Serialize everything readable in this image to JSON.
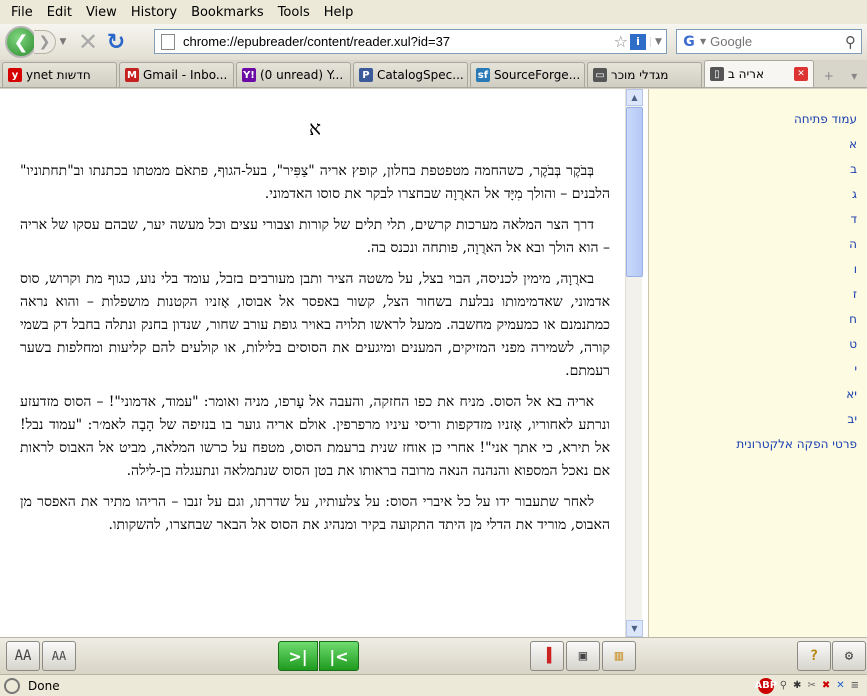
{
  "menubar": {
    "items": [
      "File",
      "Edit",
      "View",
      "History",
      "Bookmarks",
      "Tools",
      "Help"
    ]
  },
  "navbar": {
    "url": "chrome://epubreader/content/reader.xul?id=37",
    "search_placeholder": "Google"
  },
  "tabs": [
    {
      "label": "ynet חדשות",
      "icon": "ynet-icon",
      "color": "#d40000",
      "glyph": "y"
    },
    {
      "label": "Gmail - Inbo...",
      "icon": "gmail-icon",
      "color": "#c5221f",
      "glyph": "M"
    },
    {
      "label": "(0 unread) Y...",
      "icon": "yahoo-icon",
      "color": "#6b0aa5",
      "glyph": "Y!"
    },
    {
      "label": "CatalogSpec...",
      "icon": "catalog-icon",
      "color": "#3a5a9a",
      "glyph": "P"
    },
    {
      "label": "SourceForge...",
      "icon": "sourceforge-icon",
      "color": "#2a7ab8",
      "glyph": "sf"
    },
    {
      "label": "מגדלי מוכר",
      "icon": "book-icon",
      "color": "#555555",
      "glyph": "▭"
    },
    {
      "label": "אריה ב",
      "icon": "page-icon",
      "color": "#555555",
      "glyph": "▯",
      "active": true
    }
  ],
  "reader": {
    "chapter": "א",
    "paragraphs": [
      "בְּבֹקֶר בְּבֹקֶר, כשהחמה מטפטפת בחלון, קופץ אריה \"צַפִּיר\", בעל-הגוף, פתאֹם ממטתו בכתנתו וב\"תחתוניו\" הלבנים – והולך מִיָּד אל הארֻוָה שבחצרו לבקר את סוסו האדמוני.",
      "דרך הצר המלאה מערכות קרשים, תלי תלים של קורות וצבורי עצים וכל מעשה יער, שבהם עסקו של אריה – הוא הולך ובא אל הארֻוָה, פותחה ונכנס בה.",
      "בארֻוָה, מימין לכניסה, הבוי בצל, על משטה הציר ותבן מעורבים בזבל, עומד בלי נוע, כגוף מת וקרוש, סוס אדמוני, שאדמימותו נבלעת בשחור הצל, קשור באפסר אל אבוסו, אָזניו הקטנות מושפלות – והוא נראה כמתנמנם או כמעמיק מחשבה. ממעל לראשו תלויה באויר גופת עורב שחור, שנדון בחנק ונתלה בחבל דק בשמי קורה, לשמירה מפני המזיקים, המענים ומיגעים את הסוסים בלילות, או קולעים להם קליעות ומחלפות בשער רעמתם.",
      "אריה בא אל הסוס. מניח את כפו החזקה, והעבה אל עָרפו, מניה ואומר: \"עמוד, אדמוני\"! – הסוס מזדעזע ונרתע לאחוריו, אָזניו מזדקפות וריסי עיניו מרפרפין. אולם אריה גוער בו בנזיפה של הָבָה לאמ׳ר: \"עמוד נבל! אל תירא, כי אתך אני\"! אחרי כן אוחז שנית ברעמת הסוס, מטפח על כרשו המלאה, מביט אל האבוס לראות אם נאכל המספוא והנהנה הנאה מרובה בראותו את בטן הסוס שנתמלאה ונתעגלה בן-לילה.",
      "לאחר שתעבור ידו על כל איברי הסוס: על צלעותיו, על שדרתו, וגם על זנבו – הריהו מתיר את האפסר מן האבוס, מוריד את הדלי מן היתד התקועה בקיר ומנהיג את הסוס אל הבאר שבחצרו, להשקותו."
    ]
  },
  "toc": {
    "items": [
      "עמוד פתיחה",
      "א",
      "ב",
      "ג",
      "ד",
      "ה",
      "ו",
      "ז",
      "ח",
      "ט",
      "י",
      "יא",
      "יב",
      "פרטי הפקה אלקטרונית"
    ]
  },
  "bottombar": {
    "font_increase": "AA",
    "font_decrease": "AA",
    "next_glyph": ">|",
    "prev_glyph": "|<"
  },
  "status": {
    "text": "Done"
  }
}
